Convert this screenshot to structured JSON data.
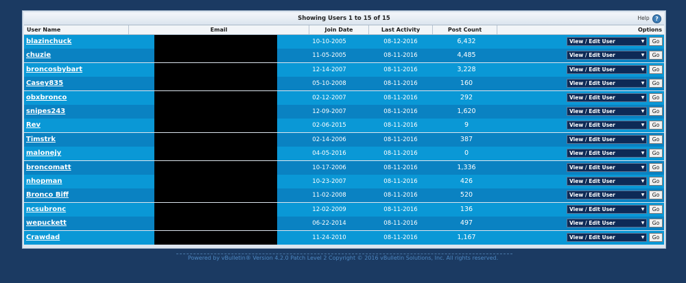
{
  "header": {
    "title": "Showing Users 1 to 15 of 15",
    "help_label": "Help",
    "help_icon": "?"
  },
  "columns": {
    "username": "User Name",
    "email": "Email",
    "join": "Join Date",
    "last": "Last Activity",
    "posts": "Post Count",
    "options": "Options"
  },
  "rows": [
    {
      "username": "blazinchuck",
      "join": "10-10-2005",
      "last": "08-12-2016",
      "posts": "6,432"
    },
    {
      "username": "chuzie",
      "join": "11-05-2005",
      "last": "08-11-2016",
      "posts": "4,485"
    },
    {
      "username": "broncosbybart",
      "join": "12-14-2007",
      "last": "08-11-2016",
      "posts": "3,228"
    },
    {
      "username": "Casey835",
      "join": "05-10-2008",
      "last": "08-11-2016",
      "posts": "160"
    },
    {
      "username": "obxbronco",
      "join": "02-12-2007",
      "last": "08-11-2016",
      "posts": "292"
    },
    {
      "username": "snipes243",
      "join": "12-09-2007",
      "last": "08-11-2016",
      "posts": "1,620"
    },
    {
      "username": "Rev",
      "join": "02-06-2015",
      "last": "08-11-2016",
      "posts": "9"
    },
    {
      "username": "Timstrk",
      "join": "02-14-2006",
      "last": "08-11-2016",
      "posts": "387"
    },
    {
      "username": "malonejy",
      "join": "04-05-2016",
      "last": "08-11-2016",
      "posts": "0"
    },
    {
      "username": "broncomatt",
      "join": "10-17-2006",
      "last": "08-11-2016",
      "posts": "1,336"
    },
    {
      "username": "nhopman",
      "join": "10-23-2007",
      "last": "08-11-2016",
      "posts": "426"
    },
    {
      "username": "Bronco Biff",
      "join": "11-02-2008",
      "last": "08-11-2016",
      "posts": "520"
    },
    {
      "username": "ncsubronc",
      "join": "12-02-2009",
      "last": "08-11-2016",
      "posts": "136"
    },
    {
      "username": "wepuckett",
      "join": "06-22-2014",
      "last": "08-11-2016",
      "posts": "497"
    },
    {
      "username": "Crawdad",
      "join": "11-24-2010",
      "last": "08-11-2016",
      "posts": "1,167"
    }
  ],
  "option_select": "View / Edit User",
  "go_label": "Go",
  "footer": "Powered by vBulletin® Version 4.2.0 Patch Level 2 Copyright © 2016 vBulletin Solutions, Inc. All rights reserved.",
  "colors": {
    "background": "#1b3a62",
    "row_light": "#0a98d6",
    "row_dark": "#0a82c2",
    "select_bg": "#0e2a56"
  }
}
